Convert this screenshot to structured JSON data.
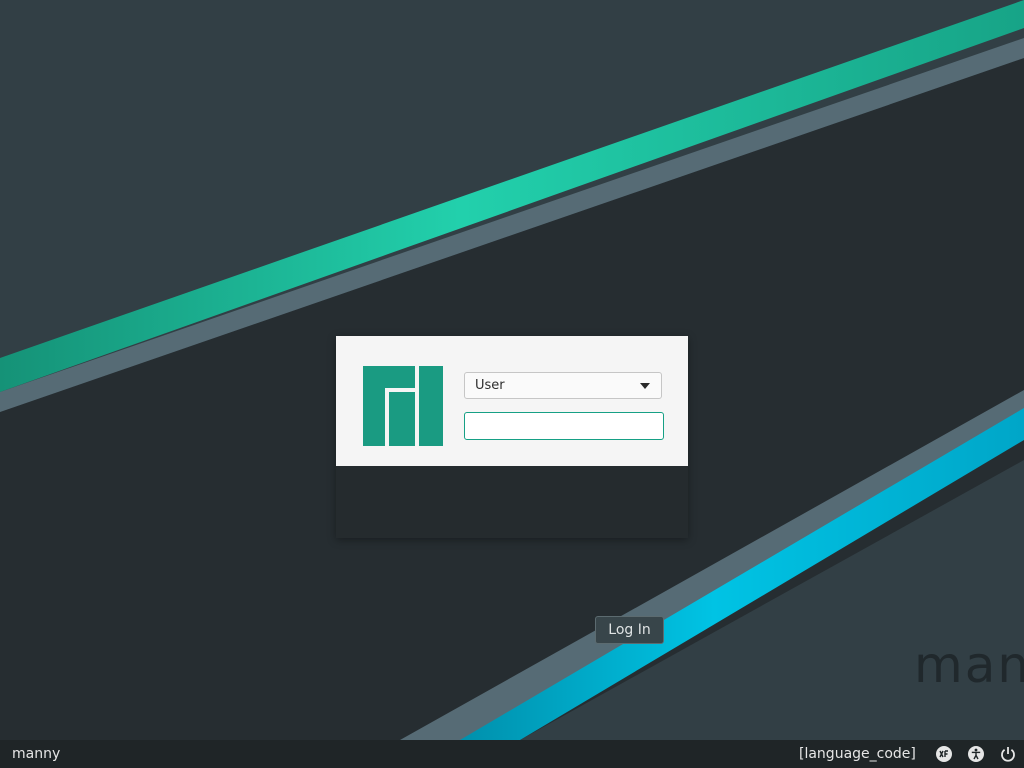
{
  "wallpaper": {
    "wordmark": "manjaro",
    "colors": {
      "background": "#262d31",
      "upper_area": "#323f45",
      "green_stripe": "#1db995",
      "gray_stripe": "#566b75",
      "cyan_stripe": "#00a6c8"
    }
  },
  "login": {
    "logo_icon": "manjaro-logo-icon",
    "user_select": {
      "selected": "User"
    },
    "password": {
      "value": "",
      "placeholder": ""
    },
    "login_button_label": "Log In",
    "colors": {
      "accent": "#16a085",
      "logo": "#1a9b82"
    }
  },
  "panel": {
    "hostname": "manny",
    "language": "[language_code]",
    "icons": [
      "session-icon",
      "accessibility-icon",
      "power-icon"
    ]
  }
}
